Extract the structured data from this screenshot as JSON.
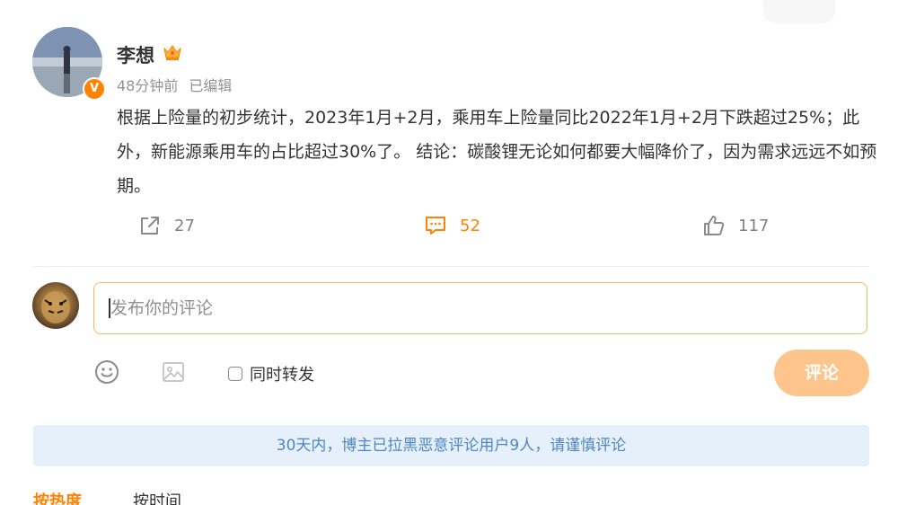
{
  "author": {
    "name": "李想",
    "verified": true,
    "badge_icon": "crown-icon"
  },
  "post": {
    "time": "48分钟前",
    "edited_label": "已编辑",
    "text": "根据上险量的初步统计，2023年1月+2月，乘用车上险量同比2022年1月+2月下跌超过25%；此外，新能源乘用车的占比超过30%了。 结论：碳酸锂无论如何都要大幅降价了，因为需求远远不如预期。"
  },
  "actions": {
    "forward_count": "27",
    "comment_count": "52",
    "like_count": "117"
  },
  "composer": {
    "placeholder": "发布你的评论",
    "repost_label": "同时转发",
    "submit_label": "评论"
  },
  "notice": {
    "text": "30天内，博主已拉黑恶意评论用户9人，请谨慎评论"
  },
  "sort_tabs": {
    "hot_label": "按热度",
    "time_label": "按时间"
  },
  "colors": {
    "accent": "#ff8200",
    "submit_disabled": "#fdc48b",
    "notice_bg": "#e5f0fa",
    "notice_text": "#4e86c0"
  }
}
